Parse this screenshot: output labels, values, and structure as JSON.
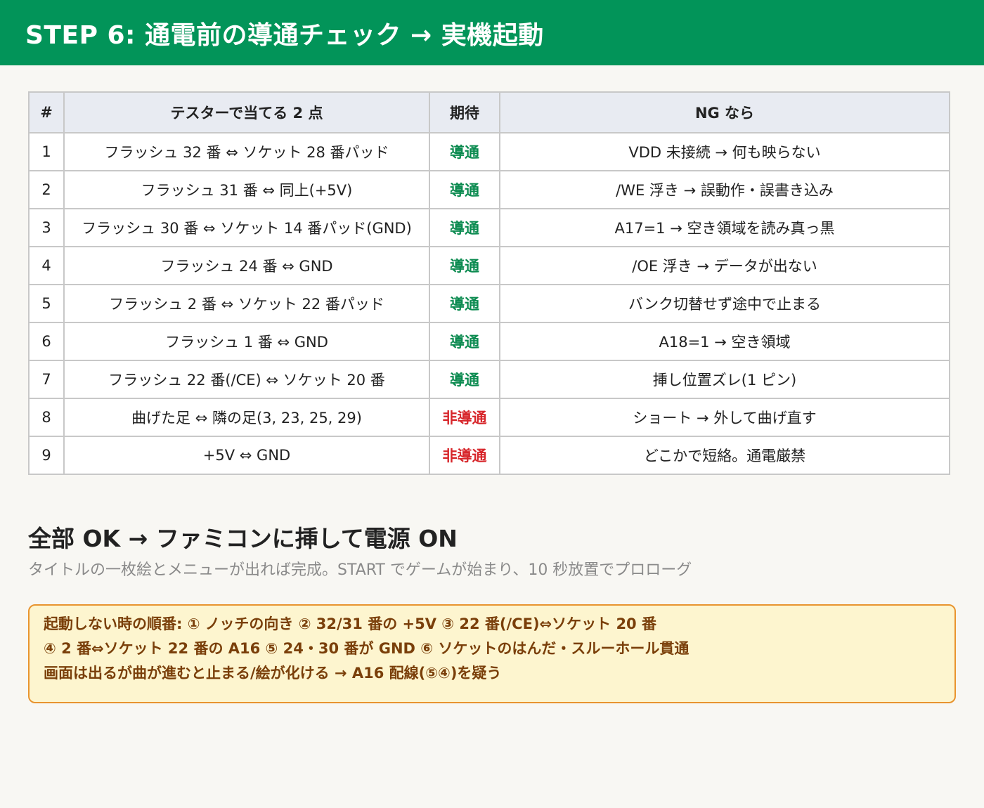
{
  "header": {
    "title": "STEP 6: 通電前の導通チェック → 実機起動"
  },
  "table": {
    "headers": [
      "#",
      "テスターで当てる 2 点",
      "期待",
      "NG なら"
    ],
    "rows": [
      {
        "no": "1",
        "points": "フラッシュ 32 番 ⇔ ソケット 28 番パッド",
        "expect": "導通",
        "status": "ok",
        "ng": "VDD 未接続 → 何も映らない"
      },
      {
        "no": "2",
        "points": "フラッシュ 31 番 ⇔ 同上(+5V)",
        "expect": "導通",
        "status": "ok",
        "ng": "/WE 浮き → 誤動作・誤書き込み"
      },
      {
        "no": "3",
        "points": "フラッシュ 30 番 ⇔ ソケット 14 番パッド(GND)",
        "expect": "導通",
        "status": "ok",
        "ng": "A17=1 → 空き領域を読み真っ黒"
      },
      {
        "no": "4",
        "points": "フラッシュ 24 番 ⇔ GND",
        "expect": "導通",
        "status": "ok",
        "ng": "/OE 浮き → データが出ない"
      },
      {
        "no": "5",
        "points": "フラッシュ 2 番 ⇔ ソケット 22 番パッド",
        "expect": "導通",
        "status": "ok",
        "ng": "バンク切替せず途中で止まる"
      },
      {
        "no": "6",
        "points": "フラッシュ 1 番 ⇔ GND",
        "expect": "導通",
        "status": "ok",
        "ng": "A18=1 → 空き領域"
      },
      {
        "no": "7",
        "points": "フラッシュ 22 番(/CE) ⇔ ソケット 20 番",
        "expect": "導通",
        "status": "ok",
        "ng": "挿し位置ズレ(1 ピン)"
      },
      {
        "no": "8",
        "points": "曲げた足 ⇔ 隣の足(3, 23, 25, 29)",
        "expect": "非導通",
        "status": "ng",
        "ng": "ショート → 外して曲げ直す"
      },
      {
        "no": "9",
        "points": "+5V ⇔ GND",
        "expect": "非導通",
        "status": "ng",
        "ng": "どこかで短絡。通電厳禁"
      }
    ]
  },
  "summary": {
    "title": "全部 OK → ファミコンに挿して電源 ON",
    "subtitle": "タイトルの一枚絵とメニューが出れば完成。START でゲームが始まり、10 秒放置でプロローグ"
  },
  "note": {
    "lines": [
      "起動しない時の順番: ① ノッチの向き ② 32/31 番の +5V ③ 22 番(/CE)⇔ソケット 20 番",
      "④ 2 番⇔ソケット 22 番の A16 ⑤ 24・30 番が GND ⑥ ソケットのはんだ・スルーホール貫通",
      "画面は出るが曲が進むと止まる/絵が化ける → A16 配線(⑤④)を疑う"
    ]
  },
  "colors": {
    "header": "#029459",
    "ok": "#0a8a4f",
    "ng": "#d7262b",
    "note_border": "#e8942f",
    "note_bg": "#fdf5cf"
  }
}
